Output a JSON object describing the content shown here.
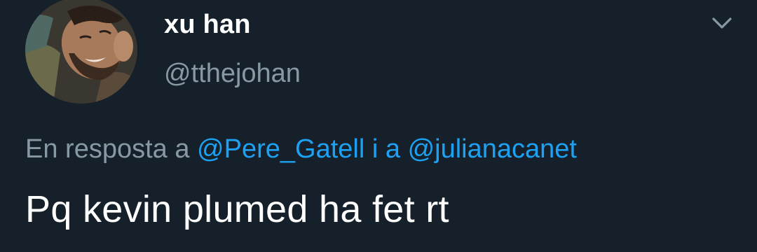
{
  "tweet": {
    "author": {
      "display_name": "xu han",
      "handle": "@tthejohan",
      "avatar_icon": "user-avatar-photo"
    },
    "menu_icon": "chevron-down-icon",
    "reply_context": {
      "prefix": "En resposta a",
      "mentions": [
        "@Pere_Gatell",
        "@julianacanet"
      ],
      "joiner": "i a"
    },
    "text": "Pq kevin plumed ha fet rt"
  },
  "colors": {
    "background": "#15202b",
    "primary_text": "#ffffff",
    "secondary_text": "#8899a6",
    "link": "#1da1f2"
  }
}
